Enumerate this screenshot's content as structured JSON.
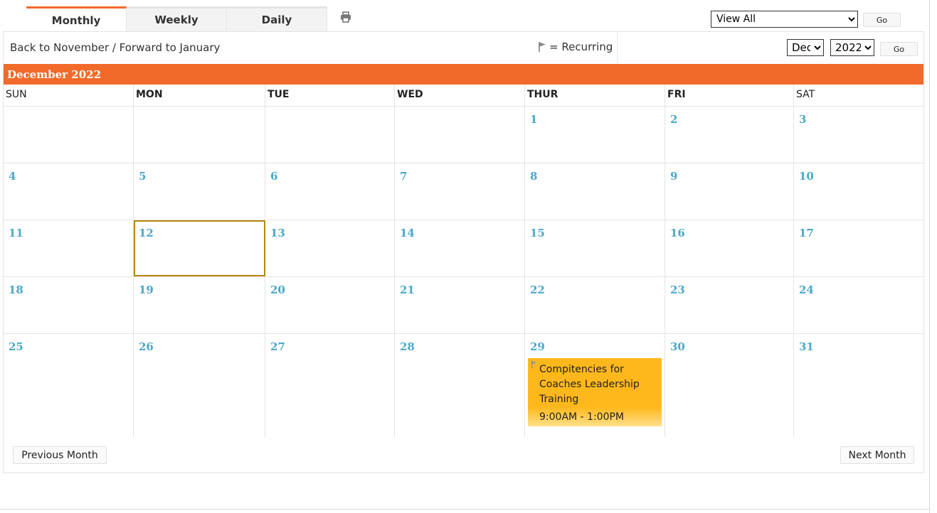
{
  "tabs": [
    {
      "label": "Monthly",
      "active": true
    },
    {
      "label": "Weekly",
      "active": false
    },
    {
      "label": "Daily",
      "active": false
    }
  ],
  "print_icon": "printer-icon",
  "filter": {
    "selected": "View All",
    "go_label": "Go"
  },
  "nav": {
    "back_label": "Back to November",
    "separator": " / ",
    "forward_label": "Forward to January"
  },
  "legend": {
    "icon": "flag-icon",
    "text": "= Recurring"
  },
  "jump": {
    "month": "Dec",
    "year": "2022",
    "go_label": "Go"
  },
  "month_title": "December 2022",
  "weekdays": [
    "SUN",
    "MON",
    "TUE",
    "WED",
    "THUR",
    "FRI",
    "SAT"
  ],
  "weeks": [
    [
      "",
      "",
      "",
      "",
      "1",
      "2",
      "3"
    ],
    [
      "4",
      "5",
      "6",
      "7",
      "8",
      "9",
      "10"
    ],
    [
      "11",
      "12",
      "13",
      "14",
      "15",
      "16",
      "17"
    ],
    [
      "18",
      "19",
      "20",
      "21",
      "22",
      "23",
      "24"
    ],
    [
      "25",
      "26",
      "27",
      "28",
      "29",
      "30",
      "31"
    ]
  ],
  "today": "12",
  "event": {
    "day": "29",
    "title": "Compitencies for Coaches Leadership Training",
    "time": "9:00AM - 1:00PM",
    "recurring": true
  },
  "footer": {
    "prev_label": "Previous Month",
    "next_label": "Next Month"
  },
  "colors": {
    "accent": "#f26a2a",
    "day_number": "#4aa8c9",
    "event_bg": "#ffb81c",
    "today_border": "#b8860b"
  }
}
